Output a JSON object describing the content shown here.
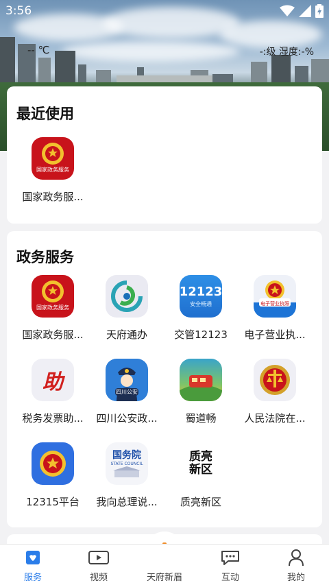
{
  "status": {
    "time": "3:56"
  },
  "weather": {
    "temp": "-- ℃",
    "aqi": "-:级 湿度:-%"
  },
  "recent": {
    "title": "最近使用",
    "apps": [
      {
        "label": "国家政务服...",
        "icon": "national-emblem-icon",
        "icon_text": "国家政务服务"
      }
    ]
  },
  "services": {
    "title": "政务服务",
    "apps": [
      {
        "label": "国家政务服...",
        "icon": "national-emblem-icon",
        "icon_text": "国家政务服务"
      },
      {
        "label": "天府通办",
        "icon": "tianfu-logo-icon"
      },
      {
        "label": "交管12123",
        "icon": "traffic-12123-icon",
        "icon_text": "12123",
        "icon_sub": "安全畅通"
      },
      {
        "label": "电子营业执...",
        "icon": "business-license-icon",
        "icon_text": "电子营业执照"
      },
      {
        "label": "税务发票助...",
        "icon": "tax-invoice-icon",
        "icon_text": "助"
      },
      {
        "label": "四川公安政...",
        "icon": "police-icon",
        "icon_text": "四川公安"
      },
      {
        "label": "蜀道畅",
        "icon": "shudao-train-icon"
      },
      {
        "label": "人民法院在...",
        "icon": "court-emblem-icon"
      },
      {
        "label": "12315平台",
        "icon": "emblem-12315-icon"
      },
      {
        "label": "我向总理说...",
        "icon": "state-council-icon",
        "icon_text": "国务院",
        "icon_sub": "STATE COUNCIL"
      },
      {
        "label": "质亮新区",
        "icon": "zhiliang-xinqu-icon",
        "icon_text": "质亮新区"
      }
    ]
  },
  "tabs": [
    {
      "label": "服务",
      "icon": "service-icon",
      "active": true
    },
    {
      "label": "视频",
      "icon": "video-icon"
    },
    {
      "label": "天府新眉",
      "icon": "home-center-icon"
    },
    {
      "label": "互动",
      "icon": "chat-icon"
    },
    {
      "label": "我的",
      "icon": "profile-icon"
    }
  ],
  "colors": {
    "accent": "#2b7de9",
    "emblem_red": "#c8131b",
    "gold": "#f2c12e"
  }
}
